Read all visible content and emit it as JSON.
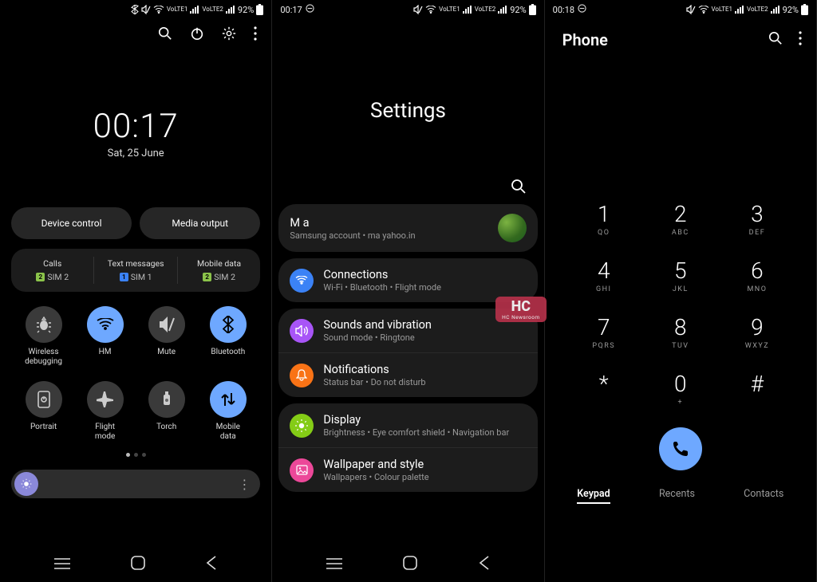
{
  "status": {
    "battery": "92%",
    "volte1": "VoLTE1",
    "volte2": "VoLTE2",
    "signal_label": "signal"
  },
  "screen1": {
    "time_sb": "",
    "clock": "00:17",
    "date": "Sat, 25 June",
    "pills": {
      "device": "Device control",
      "media": "Media output"
    },
    "sim": {
      "calls": {
        "title": "Calls",
        "chip": "2",
        "label": "SIM 2",
        "chip_color": "green"
      },
      "texts": {
        "title": "Text messages",
        "chip": "1",
        "label": "SIM 1",
        "chip_color": "blue"
      },
      "data": {
        "title": "Mobile data",
        "chip": "2",
        "label": "SIM 2",
        "chip_color": "green"
      }
    },
    "toggles": [
      {
        "name": "wireless-debugging",
        "label": "Wireless\ndebugging",
        "on": false,
        "icon": "bug"
      },
      {
        "name": "wifi-hm",
        "label": "HM",
        "on": true,
        "icon": "wifi"
      },
      {
        "name": "mute",
        "label": "Mute",
        "on": false,
        "icon": "mute"
      },
      {
        "name": "bluetooth",
        "label": "Bluetooth",
        "on": true,
        "icon": "bt"
      },
      {
        "name": "portrait",
        "label": "Portrait",
        "on": false,
        "icon": "portrait"
      },
      {
        "name": "flight-mode",
        "label": "Flight\nmode",
        "on": false,
        "icon": "plane"
      },
      {
        "name": "torch",
        "label": "Torch",
        "on": false,
        "icon": "torch"
      },
      {
        "name": "mobile-data",
        "label": "Mobile\ndata",
        "on": true,
        "icon": "arrows"
      }
    ]
  },
  "screen2": {
    "time_sb": "00:17",
    "title": "Settings",
    "account": {
      "name": "M                        a",
      "sub": "Samsung account  •  ma               yahoo.in"
    },
    "items": [
      {
        "icon_bg": "#3b82f6",
        "icon": "wifi",
        "title": "Connections",
        "sub": "Wi-Fi  •  Bluetooth  •  Flight mode"
      },
      {
        "icon_bg": "#a855f7",
        "icon": "sound",
        "title": "Sounds and vibration",
        "sub": "Sound mode  •  Ringtone"
      },
      {
        "icon_bg": "#f97316",
        "icon": "bell",
        "title": "Notifications",
        "sub": "Status bar  •  Do not disturb"
      },
      {
        "icon_bg": "#84cc16",
        "icon": "sun",
        "title": "Display",
        "sub": "Brightness  •  Eye comfort shield  •  Navigation bar"
      },
      {
        "icon_bg": "#ec4899",
        "icon": "image",
        "title": "Wallpaper and style",
        "sub": "Wallpapers  •  Colour palette"
      }
    ],
    "watermark": {
      "big": "HC",
      "small": "HC Newsroom"
    }
  },
  "screen3": {
    "time_sb": "00:18",
    "title": "Phone",
    "keys": [
      {
        "d": "1",
        "l": "QO"
      },
      {
        "d": "2",
        "l": "ABC"
      },
      {
        "d": "3",
        "l": "DEF"
      },
      {
        "d": "4",
        "l": "GHI"
      },
      {
        "d": "5",
        "l": "JKL"
      },
      {
        "d": "6",
        "l": "MNO"
      },
      {
        "d": "7",
        "l": "PQRS"
      },
      {
        "d": "8",
        "l": "TUV"
      },
      {
        "d": "9",
        "l": "WXYZ"
      },
      {
        "d": "*",
        "l": ""
      },
      {
        "d": "0",
        "l": "+"
      },
      {
        "d": "#",
        "l": ""
      }
    ],
    "tabs": {
      "keypad": "Keypad",
      "recents": "Recents",
      "contacts": "Contacts"
    }
  }
}
